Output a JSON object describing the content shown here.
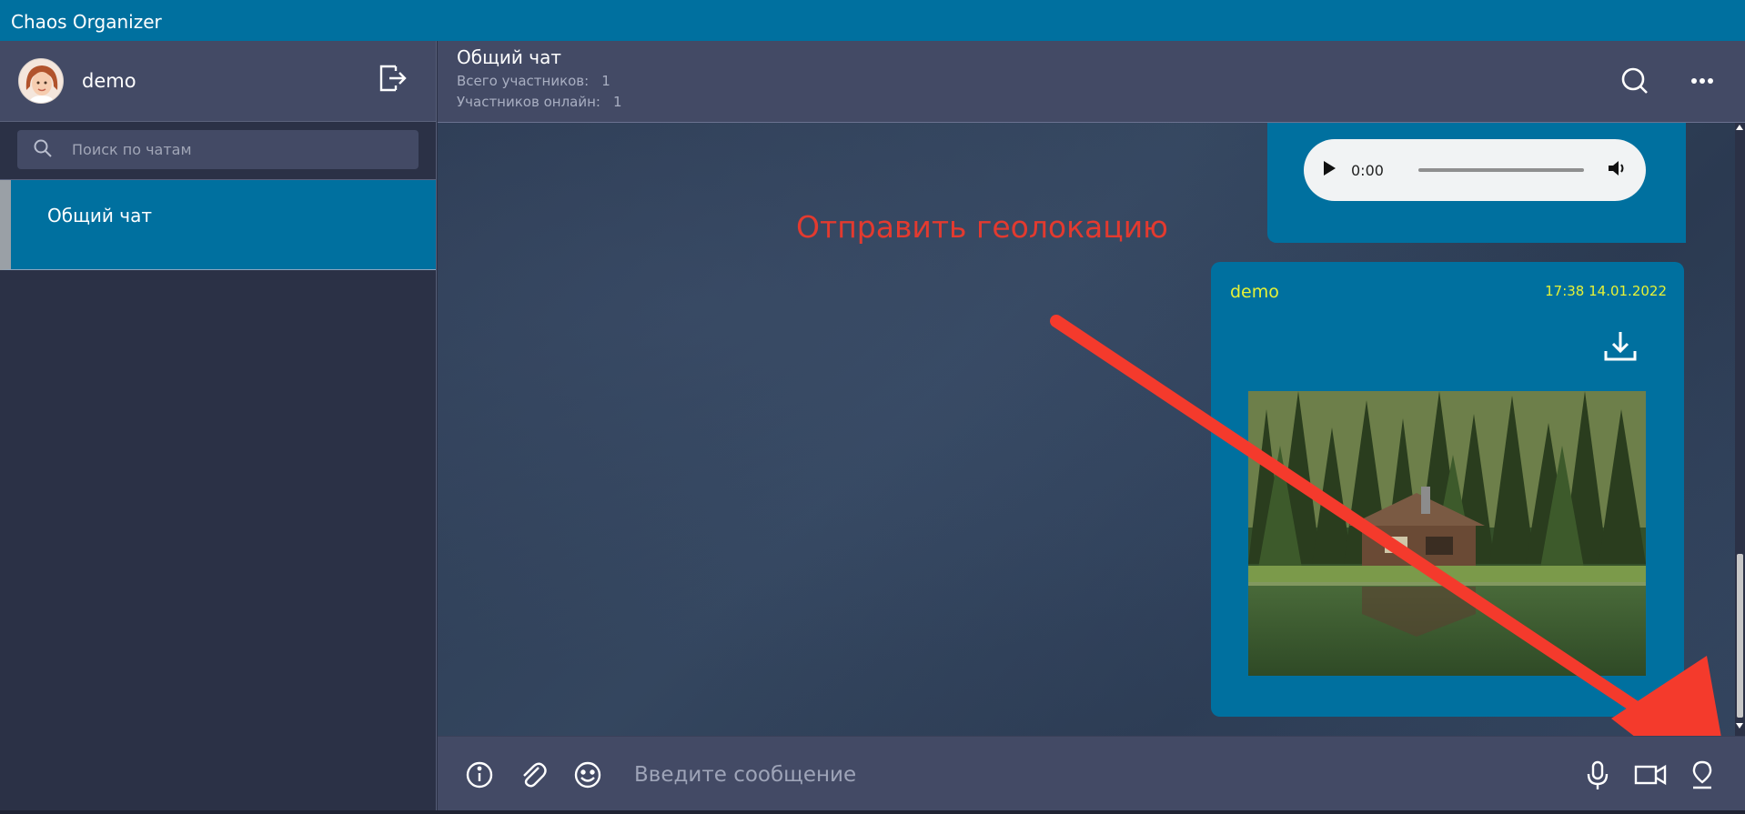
{
  "app": {
    "title": "Chaos Organizer"
  },
  "profile": {
    "username": "demo"
  },
  "search": {
    "placeholder": "Поиск по чатам"
  },
  "chats": [
    {
      "label": "Общий чат",
      "active": true
    }
  ],
  "header": {
    "title": "Общий чат",
    "total_label": "Всего участников:",
    "total_value": "1",
    "online_label": "Участников онлайн:",
    "online_value": "1"
  },
  "messages": [
    {
      "type": "audio",
      "time": "0:00"
    },
    {
      "type": "image",
      "author": "demo",
      "timestamp": "17:38 14.01.2022"
    }
  ],
  "annotation": {
    "text": "Отправить геолокацию",
    "color": "#e33a2f"
  },
  "composer": {
    "placeholder": "Введите сообщение"
  },
  "icons": [
    "logout-icon",
    "search-icon",
    "more-icon",
    "play-icon",
    "volume-icon",
    "download-icon",
    "info-icon",
    "attach-icon",
    "emoji-icon",
    "microphone-icon",
    "video-camera-icon",
    "geolocation-icon"
  ],
  "colors": {
    "accent": "#00709f",
    "author": "#e7f236",
    "panel": "#434a65",
    "background": "#2b3146"
  }
}
